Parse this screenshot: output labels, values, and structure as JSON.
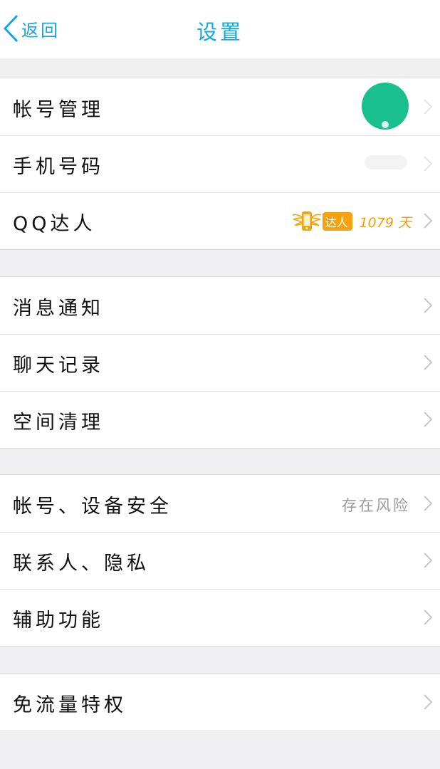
{
  "navbar": {
    "back_label": "返回",
    "title": "设置"
  },
  "groups": [
    {
      "rows": [
        {
          "label": "帐号管理"
        },
        {
          "label": "手机号码"
        },
        {
          "label": "QQ达人",
          "badge_text": "达人",
          "days": "1079 天"
        }
      ]
    },
    {
      "rows": [
        {
          "label": "消息通知"
        },
        {
          "label": "聊天记录"
        },
        {
          "label": "空间清理"
        }
      ]
    },
    {
      "rows": [
        {
          "label": "帐号、设备安全",
          "value": "存在风险"
        },
        {
          "label": "联系人、隐私"
        },
        {
          "label": "辅助功能"
        }
      ]
    },
    {
      "rows": [
        {
          "label": "免流量特权"
        }
      ]
    }
  ],
  "colors": {
    "accent": "#12a8e8",
    "daren_orange": "#f4a30f",
    "avatar_green": "#19c08e"
  }
}
